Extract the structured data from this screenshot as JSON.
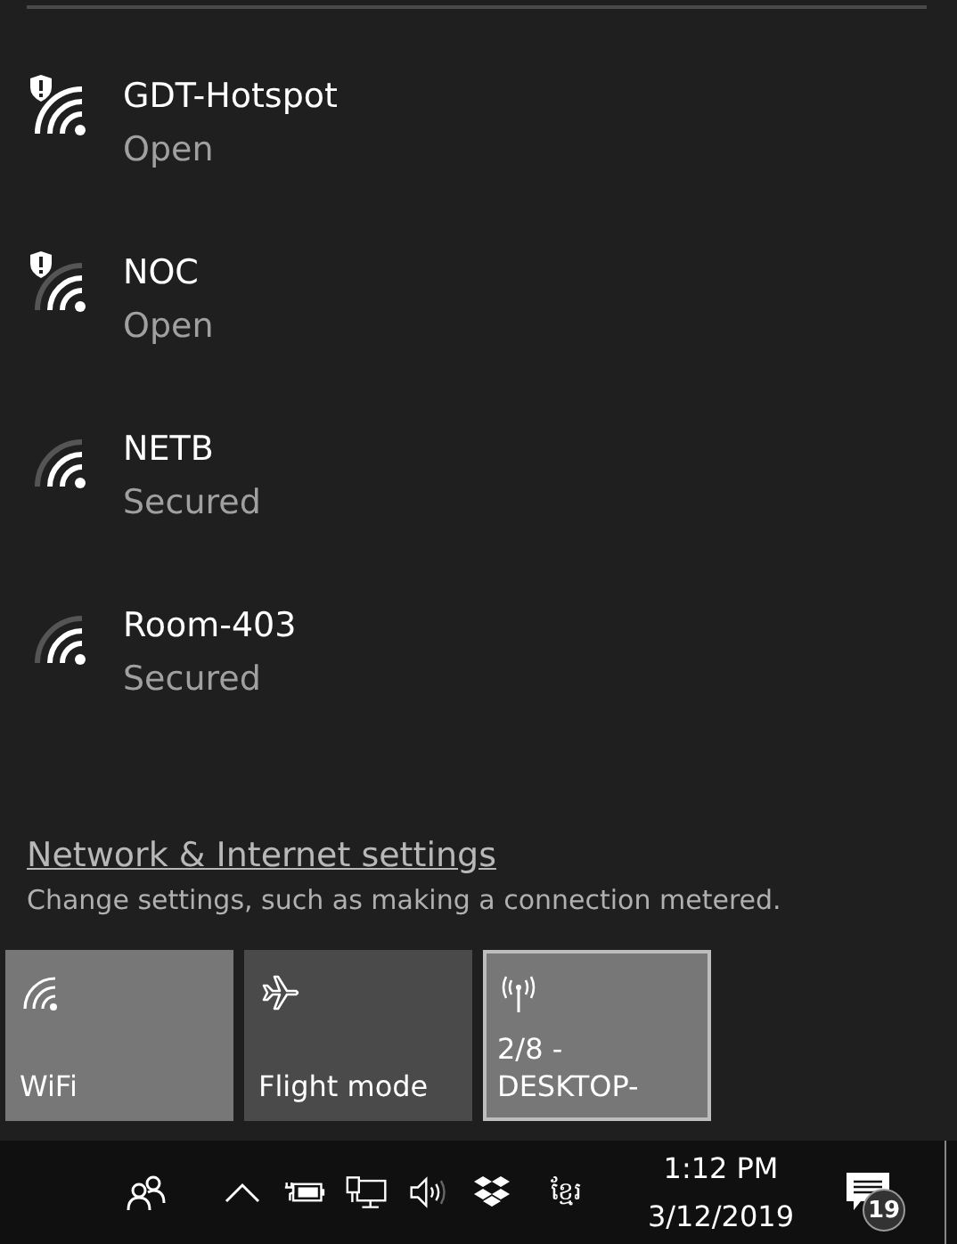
{
  "networks": [
    {
      "name": "GDT-Hotspot",
      "status": "Open",
      "warning": true,
      "full_signal": true
    },
    {
      "name": "NOC",
      "status": "Open",
      "warning": true,
      "full_signal": false
    },
    {
      "name": "NETB",
      "status": "Secured",
      "warning": false,
      "full_signal": false
    },
    {
      "name": "Room-403",
      "status": "Secured",
      "warning": false,
      "full_signal": false
    }
  ],
  "settings_link": "Network & Internet settings",
  "settings_hint": "Change settings, such as making a connection metered.",
  "quick_actions": [
    {
      "kind": "wifi",
      "label": "WiFi",
      "on": true,
      "focused": false
    },
    {
      "kind": "flight",
      "label": "Flight mode",
      "on": false,
      "focused": false
    },
    {
      "kind": "hotspot",
      "label": "2/8 - DESKTOP-",
      "on": true,
      "focused": true
    }
  ],
  "taskbar": {
    "language": "ខ្មែរ",
    "time": "1:12 PM",
    "date": "3/12/2019",
    "notification_count": "19"
  }
}
